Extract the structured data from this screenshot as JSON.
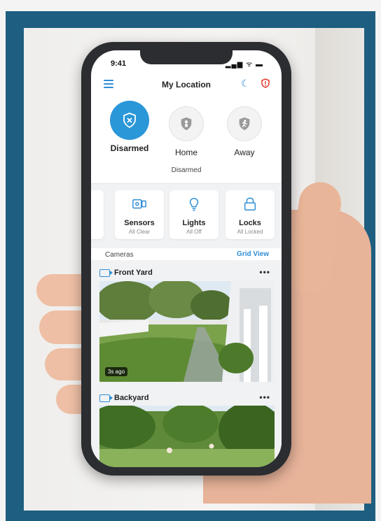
{
  "status_bar": {
    "time": "9:41",
    "indicators": "▂▄▆ ᯤ ▬"
  },
  "header": {
    "title": "My Location"
  },
  "modes": {
    "disarmed_label": "Disarmed",
    "home_label": "Home",
    "away_label": "Away",
    "current_status": "Disarmed"
  },
  "tiles": [
    {
      "label": "Sensors",
      "sub": "All Clear"
    },
    {
      "label": "Lights",
      "sub": "All Off"
    },
    {
      "label": "Locks",
      "sub": "All Locked"
    }
  ],
  "cameras": {
    "section_label": "Cameras",
    "grid_view_label": "Grid View",
    "feeds": [
      {
        "name": "Front Yard",
        "age": "3s ago"
      },
      {
        "name": "Backyard"
      }
    ],
    "more_glyph": "•••"
  },
  "colors": {
    "frame": "#1e5e80",
    "accent": "#2a97d8",
    "alert": "#e0352b"
  }
}
